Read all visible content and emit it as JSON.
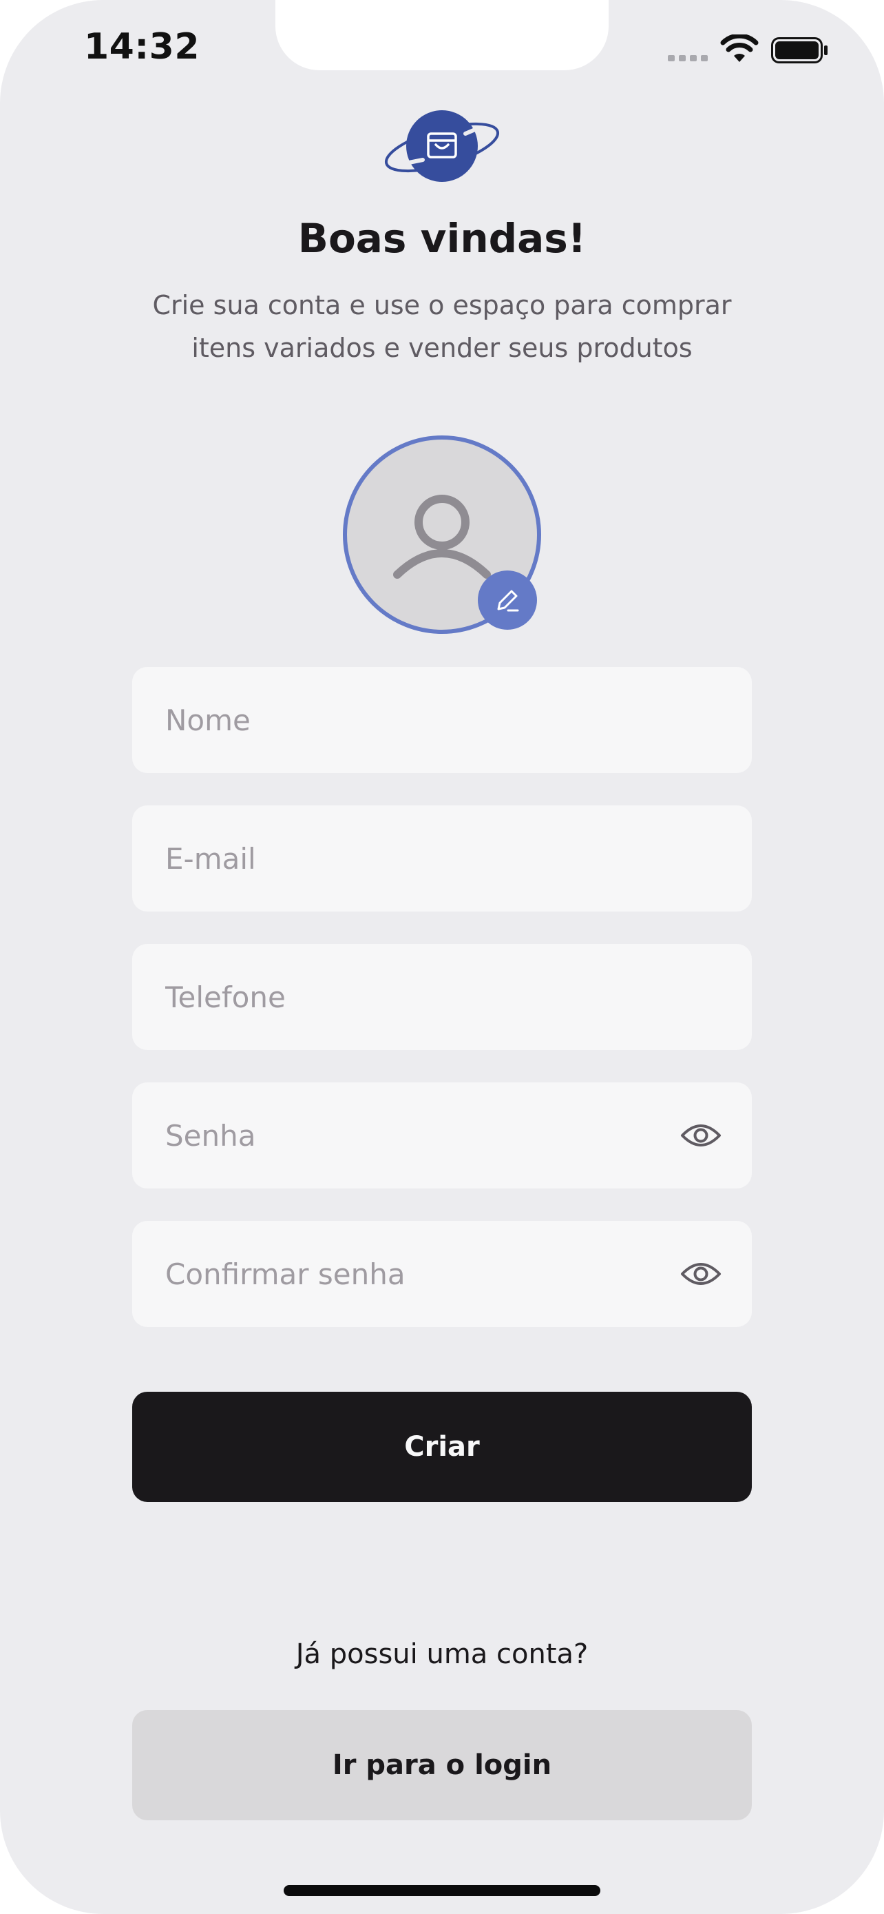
{
  "status_bar": {
    "time": "14:32"
  },
  "header": {
    "title": "Boas vindas!",
    "subtitle": "Crie sua conta e use o espaço para comprar itens variados e vender seus produtos"
  },
  "form": {
    "name_placeholder": "Nome",
    "email_placeholder": "E-mail",
    "phone_placeholder": "Telefone",
    "password_placeholder": "Senha",
    "confirm_password_placeholder": "Confirmar senha",
    "name_value": "",
    "email_value": "",
    "phone_value": "",
    "password_value": "",
    "confirm_password_value": "",
    "submit_label": "Criar"
  },
  "footer": {
    "prompt": "Já possui uma conta?",
    "login_label": "Ir para o login"
  },
  "icons": {
    "logo": "shopping-bag-planet-icon",
    "avatar": "user-icon",
    "edit": "pencil-icon",
    "password_toggle": "eye-icon"
  },
  "colors": {
    "background": "#ECECEF",
    "field_background": "#F7F7F8",
    "brand_blue": "#364D9D",
    "accent_blue": "#647AC7",
    "primary_button": "#1A181B",
    "secondary_button": "#D9D8DA",
    "placeholder": "#9F9BA1",
    "subtitle": "#5F5B62"
  }
}
